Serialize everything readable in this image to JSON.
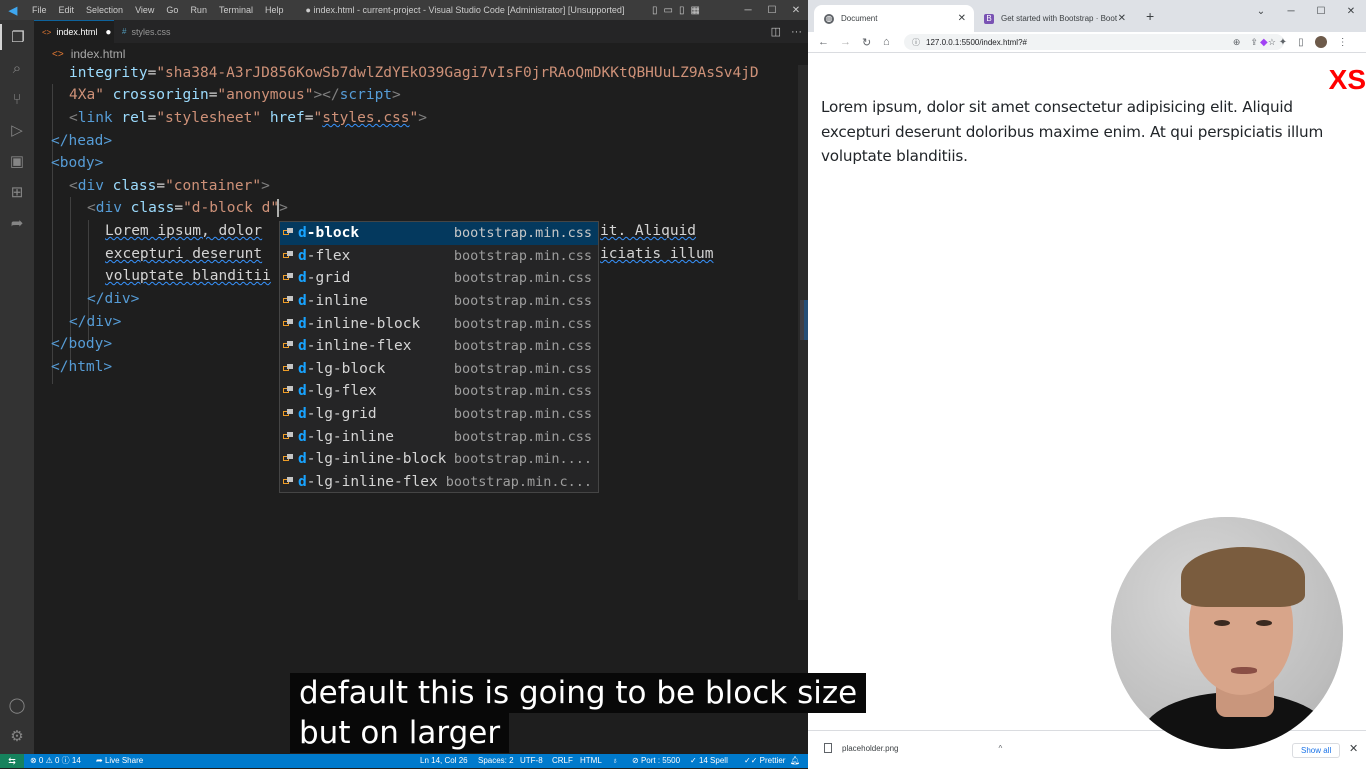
{
  "vscode": {
    "menu": [
      "File",
      "Edit",
      "Selection",
      "View",
      "Go",
      "Run",
      "Terminal",
      "Help"
    ],
    "window_title": "● index.html - current-project - Visual Studio Code [Administrator] [Unsupported]",
    "tabs": [
      {
        "label": "index.html",
        "active": true,
        "modified": true
      },
      {
        "label": "styles.css",
        "active": false,
        "modified": false
      }
    ],
    "breadcrumb": "index.html",
    "code_lines": {
      "l1_attr": "integrity",
      "l1_eq": "=",
      "l1_val": "\"sha384-A3rJD856KowSb7dwlZdYEkO39Gagi7vIsF0jrRAoQmDKKtQBHUuLZ9AsSv4jD",
      "l2_val": "4Xa\"",
      "l2_attr": "crossorigin",
      "l2_eq": "=",
      "l2_val2": "\"anonymous\"",
      "l2_close": "></",
      "l2_tag": "script",
      "l2_end": ">",
      "l3_open": "<",
      "l3_tag": "link",
      "l3_attr1": "rel",
      "l3_val1": "\"stylesheet\"",
      "l3_attr2": "href",
      "l3_q1": "\"",
      "l3_val2": "styles.css",
      "l3_q2": "\"",
      "l3_end": ">",
      "l4": "</head>",
      "l5": "<body>",
      "l6_tag": "div",
      "l6_attr": "class",
      "l6_val": "\"container\"",
      "l7_tag": "div",
      "l7_attr": "class",
      "l7_val": "\"d-block d\"",
      "l8a": "Lorem ipsum, dolor",
      "l8b": "it. Aliquid",
      "l9a": "excepturi deserunt",
      "l9b": "iciatis illum",
      "l10a": "voluptate blanditii",
      "l11": "</div>",
      "l12": "</div>",
      "l13": "</body>",
      "l14": "</html>"
    },
    "suggestions": [
      {
        "prefix": "d",
        "rest": "-block",
        "source": "bootstrap.min.css",
        "selected": true
      },
      {
        "prefix": "d",
        "rest": "-flex",
        "source": "bootstrap.min.css",
        "selected": false
      },
      {
        "prefix": "d",
        "rest": "-grid",
        "source": "bootstrap.min.css",
        "selected": false
      },
      {
        "prefix": "d",
        "rest": "-inline",
        "source": "bootstrap.min.css",
        "selected": false
      },
      {
        "prefix": "d",
        "rest": "-inline-block",
        "source": "bootstrap.min.css",
        "selected": false
      },
      {
        "prefix": "d",
        "rest": "-inline-flex",
        "source": "bootstrap.min.css",
        "selected": false
      },
      {
        "prefix": "d",
        "rest": "-lg-block",
        "source": "bootstrap.min.css",
        "selected": false
      },
      {
        "prefix": "d",
        "rest": "-lg-flex",
        "source": "bootstrap.min.css",
        "selected": false
      },
      {
        "prefix": "d",
        "rest": "-lg-grid",
        "source": "bootstrap.min.css",
        "selected": false
      },
      {
        "prefix": "d",
        "rest": "-lg-inline",
        "source": "bootstrap.min.css",
        "selected": false
      },
      {
        "prefix": "d",
        "rest": "-lg-inline-block",
        "source": "bootstrap.min....",
        "selected": false
      },
      {
        "prefix": "d",
        "rest": "-lg-inline-flex",
        "source": "bootstrap.min.c...",
        "selected": false
      }
    ],
    "status": {
      "problems": "⊗ 0 ⚠ 0 ⓘ 14",
      "live_share": "Live Share",
      "position": "Ln 14, Col 26",
      "spaces": "Spaces: 2",
      "encoding": "UTF-8",
      "eol": "CRLF",
      "language": "HTML",
      "port": "Port : 5500",
      "spell": "14 Spell",
      "prettier": "Prettier"
    },
    "colors": {
      "statusbar": "#007acc",
      "selection": "#04395e",
      "match": "#18a3ff"
    }
  },
  "chrome": {
    "tabs": [
      {
        "title": "Document",
        "active": true
      },
      {
        "title": "Get started with Bootstrap · Boot",
        "active": false
      }
    ],
    "url": "127.0.0.1:5500/index.html?#",
    "page": {
      "badge": "XS",
      "paragraph": "Lorem ipsum, dolor sit amet consectetur adipisicing elit. Aliquid excepturi deserunt doloribus maxime enim. At qui perspiciatis illum voluptate blanditiis."
    },
    "download": {
      "filename": "placeholder.png",
      "show_all": "Show all"
    }
  },
  "captions": {
    "line1": "default this is going to be block size",
    "line2": "but on larger"
  }
}
